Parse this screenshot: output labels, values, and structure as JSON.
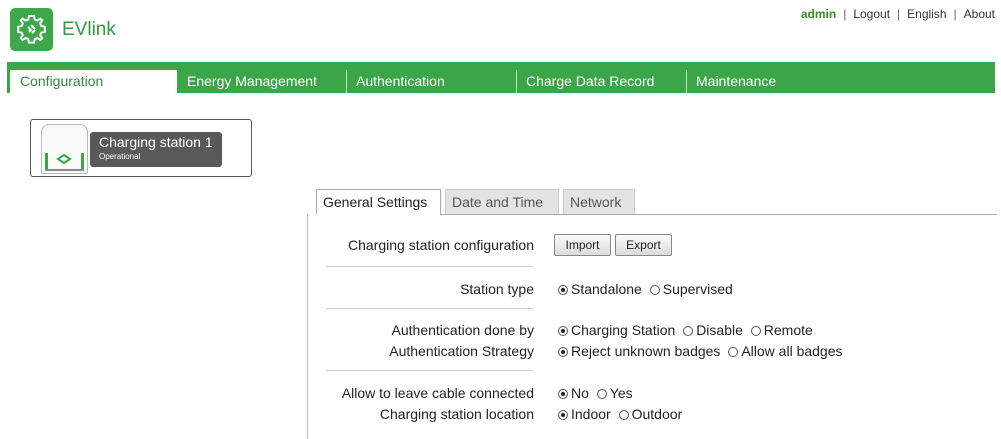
{
  "app": {
    "name": "EVlink"
  },
  "topnav": {
    "user": "admin",
    "logout": "Logout",
    "language": "English",
    "about": "About"
  },
  "tabs": [
    {
      "label": "Configuration",
      "active": true
    },
    {
      "label": "Energy Management"
    },
    {
      "label": "Authentication"
    },
    {
      "label": "Charge Data Record"
    },
    {
      "label": "Maintenance"
    }
  ],
  "station": {
    "name": "Charging station 1",
    "status": "Operational"
  },
  "subtabs": [
    {
      "label": "General Settings",
      "active": true
    },
    {
      "label": "Date and Time"
    },
    {
      "label": "Network"
    }
  ],
  "settings": {
    "config_label": "Charging station configuration",
    "import": "Import",
    "export": "Export",
    "station_type": {
      "label": "Station type",
      "options": [
        "Standalone",
        "Supervised"
      ],
      "selected": "Standalone"
    },
    "auth_done_by": {
      "label": "Authentication done by",
      "options": [
        "Charging Station",
        "Disable",
        "Remote"
      ],
      "selected": "Charging Station"
    },
    "auth_strategy": {
      "label": "Authentication Strategy",
      "options": [
        "Reject unknown badges",
        "Allow all badges"
      ],
      "selected": "Reject unknown badges"
    },
    "leave_cable": {
      "label": "Allow to leave cable connected",
      "options": [
        "No",
        "Yes"
      ],
      "selected": "No"
    },
    "location": {
      "label": "Charging station location",
      "options": [
        "Indoor",
        "Outdoor"
      ],
      "selected": "Indoor"
    }
  },
  "colors": {
    "brand": "#3aa648",
    "brand_text": "#2f9a3d"
  }
}
